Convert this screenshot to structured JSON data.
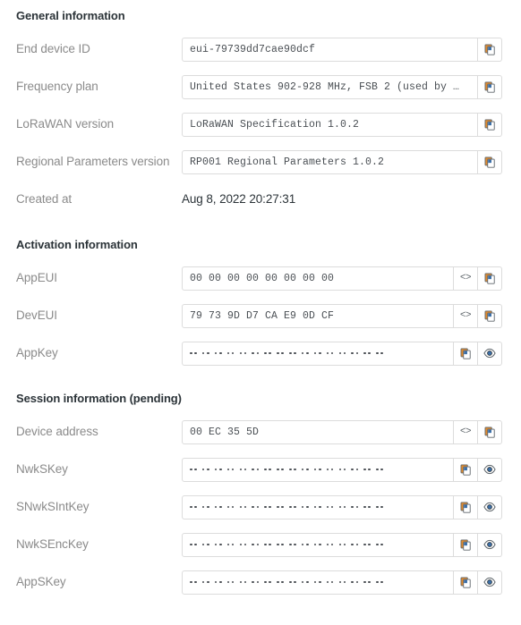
{
  "sections": [
    {
      "title": "General information",
      "rows": [
        {
          "label": "End device ID",
          "type": "text",
          "value": "eui-79739dd7cae90dcf",
          "buttons": [
            "copy-icon"
          ]
        },
        {
          "label": "Frequency plan",
          "type": "text",
          "value": "United States 902-928 MHz, FSB 2 (used by …",
          "buttons": [
            "copy-icon"
          ]
        },
        {
          "label": "LoRaWAN version",
          "type": "text",
          "value": "LoRaWAN Specification 1.0.2",
          "buttons": [
            "copy-icon"
          ]
        },
        {
          "label": "Regional Parameters version",
          "type": "text",
          "value": "RP001 Regional Parameters 1.0.2",
          "buttons": [
            "copy-icon"
          ]
        },
        {
          "label": "Created at",
          "type": "plain",
          "value": "Aug 8, 2022 20:27:31",
          "buttons": []
        }
      ]
    },
    {
      "title": "Activation information",
      "rows": [
        {
          "label": "AppEUI",
          "type": "text",
          "value": "00 00 00 00 00 00 00 00",
          "buttons": [
            "code-icon",
            "copy-icon"
          ]
        },
        {
          "label": "DevEUI",
          "type": "text",
          "value": "79 73 9D D7 CA E9 0D CF",
          "buttons": [
            "code-icon",
            "copy-icon"
          ]
        },
        {
          "label": "AppKey",
          "type": "masked",
          "value": "",
          "mask_pairs": 16,
          "buttons": [
            "copy-icon",
            "eye-icon"
          ]
        }
      ]
    },
    {
      "title": "Session information (pending)",
      "rows": [
        {
          "label": "Device address",
          "type": "text",
          "value": "00 EC 35 5D",
          "buttons": [
            "code-icon",
            "copy-icon"
          ]
        },
        {
          "label": "NwkSKey",
          "type": "masked",
          "value": "",
          "mask_pairs": 16,
          "buttons": [
            "copy-icon",
            "eye-icon"
          ]
        },
        {
          "label": "SNwkSIntKey",
          "type": "masked",
          "value": "",
          "mask_pairs": 16,
          "buttons": [
            "copy-icon",
            "eye-icon"
          ]
        },
        {
          "label": "NwkSEncKey",
          "type": "masked",
          "value": "",
          "mask_pairs": 16,
          "buttons": [
            "copy-icon",
            "eye-icon"
          ]
        },
        {
          "label": "AppSKey",
          "type": "masked",
          "value": "",
          "mask_pairs": 16,
          "buttons": [
            "copy-icon",
            "eye-icon"
          ]
        }
      ]
    }
  ],
  "icons": {
    "code_glyph": "<>"
  },
  "colors": {
    "label": "#8b8b8b",
    "value": "#4a4f54",
    "heading": "#2b3338",
    "border": "#dcdcdc",
    "background": "#ffffff"
  }
}
